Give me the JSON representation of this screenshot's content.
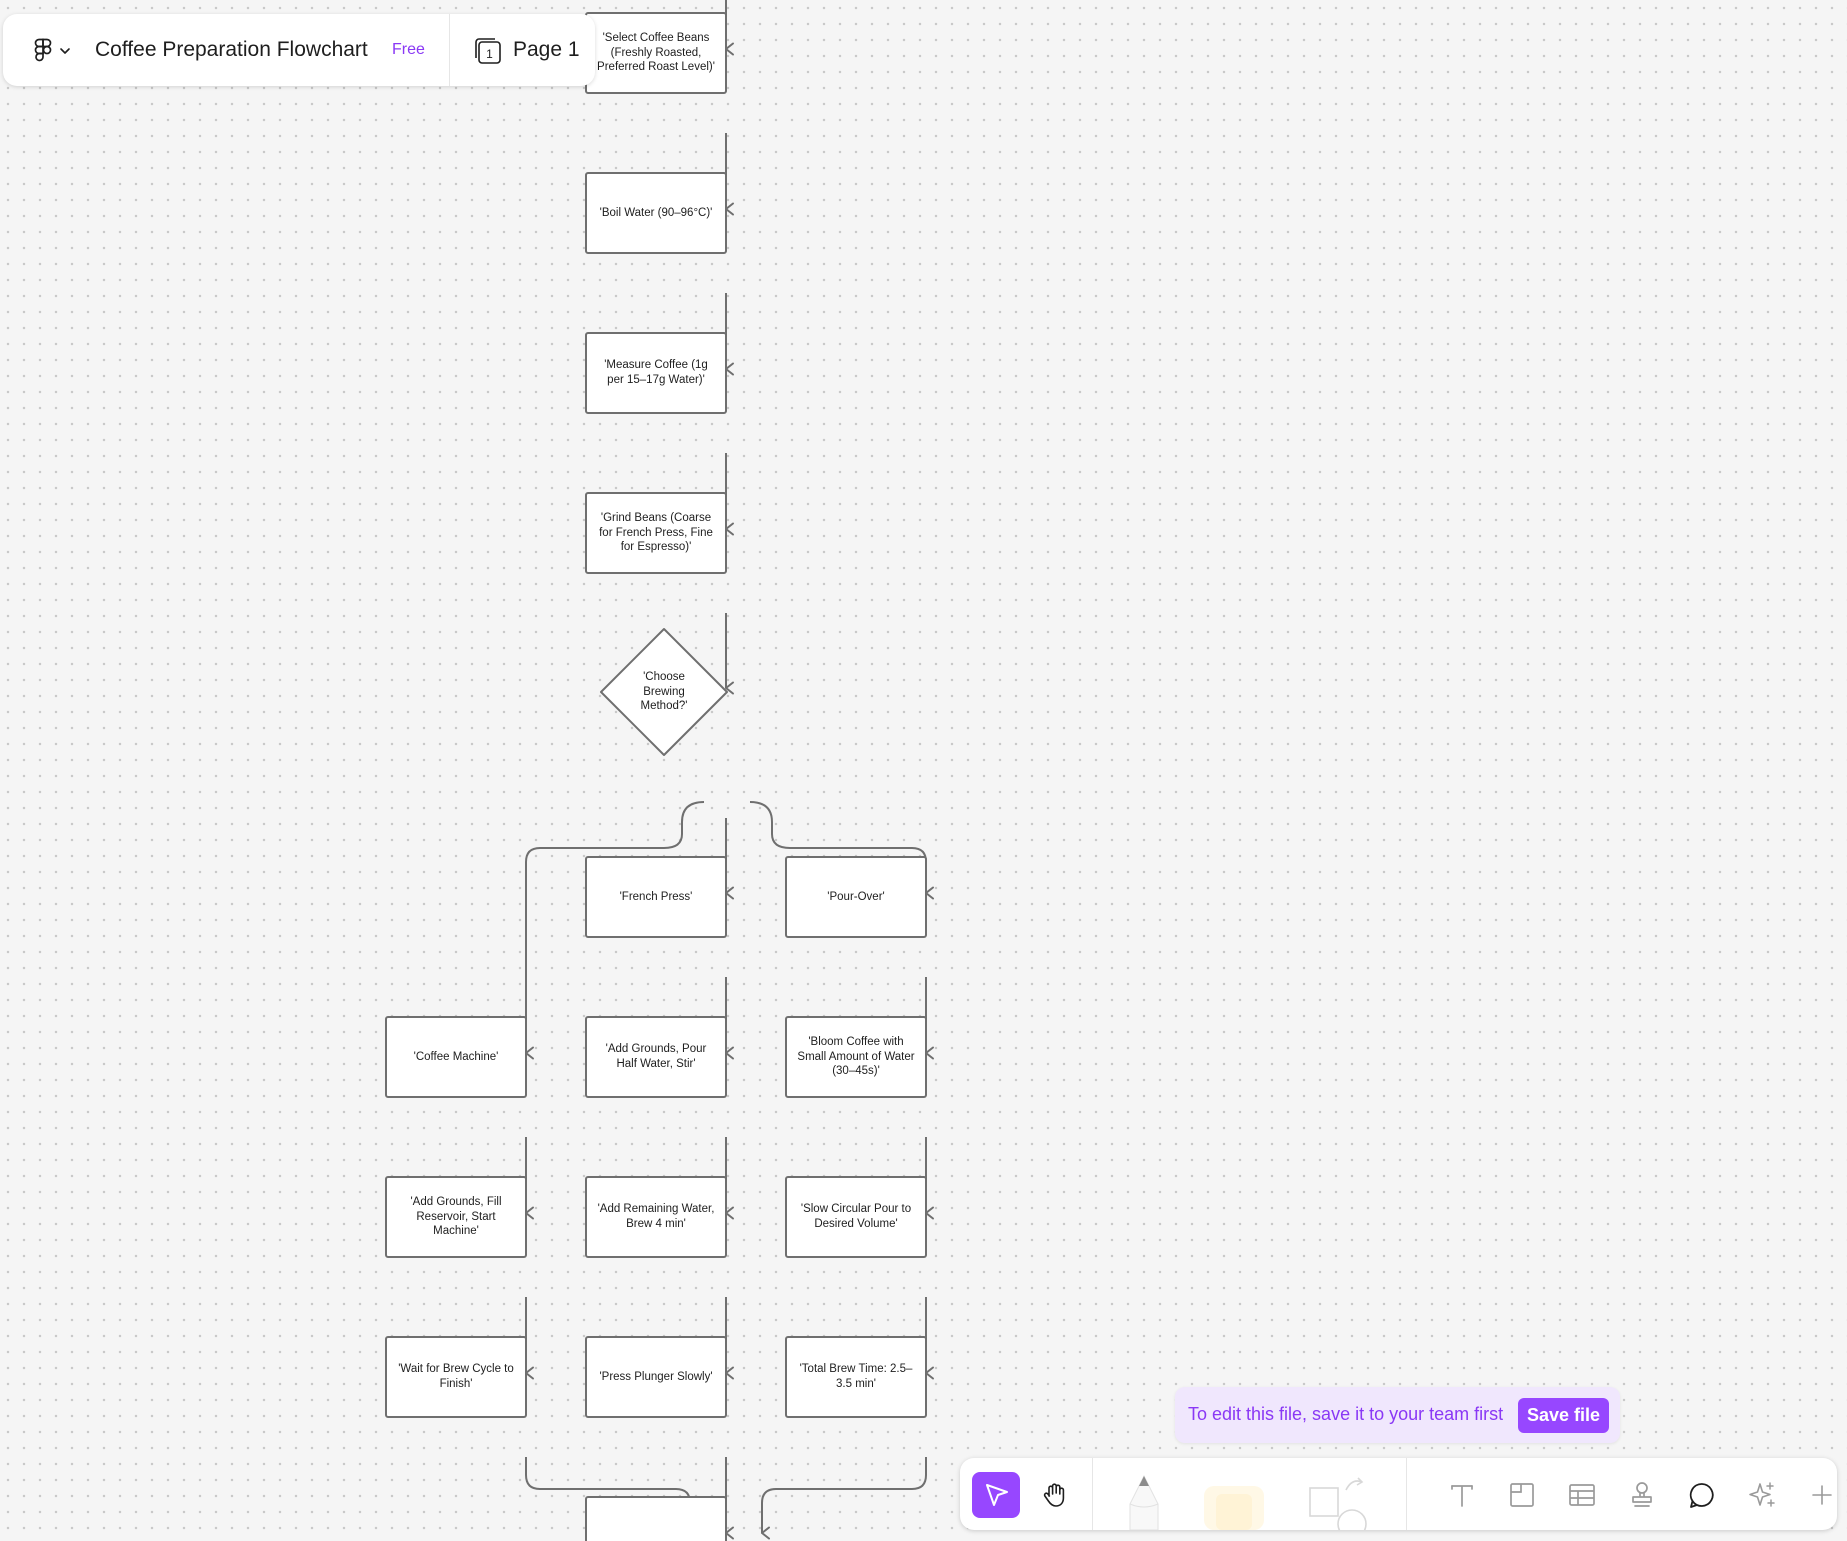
{
  "header": {
    "title": "Coffee Preparation Flowchart",
    "plan_badge": "Free",
    "page_label": "Page 1",
    "page_count": "1"
  },
  "banner": {
    "text": "To edit this file, save it to your team first",
    "button_label": "Save file"
  },
  "toolbar": {
    "tools": [
      {
        "id": "move",
        "icon": "cursor-icon",
        "active": true
      },
      {
        "id": "hand",
        "icon": "hand-icon"
      },
      {
        "id": "pen",
        "icon": "pen-icon"
      },
      {
        "id": "highlighter",
        "icon": "highlighter-icon"
      },
      {
        "id": "shapes",
        "icon": "shape-icon"
      },
      {
        "id": "text",
        "icon": "text-icon"
      },
      {
        "id": "section",
        "icon": "section-icon"
      },
      {
        "id": "table",
        "icon": "table-icon"
      },
      {
        "id": "stamp",
        "icon": "stamp-icon"
      },
      {
        "id": "comment",
        "icon": "comment-icon"
      },
      {
        "id": "ai",
        "icon": "sparkle-icon"
      },
      {
        "id": "more",
        "icon": "plus-icon"
      }
    ],
    "accent": "#9747ff"
  },
  "colors": {
    "stroke": "#6f6f6f",
    "node_fill": "#ffffff",
    "canvas": "#f5f5f5",
    "accent_text": "#8a38f5",
    "banner_bg": "#f0e7fd"
  },
  "diagram": {
    "nodes": [
      {
        "id": "select_beans",
        "shape": "rect",
        "text": "'Select Coffee Beans (Freshly Roasted, Preferred Roast Level)'"
      },
      {
        "id": "boil_water",
        "shape": "rect",
        "text": "'Boil Water (90–96°C)'"
      },
      {
        "id": "measure",
        "shape": "rect",
        "text": "'Measure Coffee (1g per 15–17g Water)'"
      },
      {
        "id": "grind",
        "shape": "rect",
        "text": "'Grind Beans (Coarse for French Press, Fine for Espresso)'"
      },
      {
        "id": "choose",
        "shape": "diamond",
        "text": "'Choose Brewing Method?'"
      },
      {
        "id": "french_press",
        "shape": "rect",
        "text": "'French Press'"
      },
      {
        "id": "pour_over",
        "shape": "rect",
        "text": "'Pour-Over'"
      },
      {
        "id": "coffee_machine",
        "shape": "rect",
        "text": "'Coffee Machine'"
      },
      {
        "id": "fp_add",
        "shape": "rect",
        "text": "'Add Grounds, Pour Half Water, Stir'"
      },
      {
        "id": "po_bloom",
        "shape": "rect",
        "text": "'Bloom Coffee with Small Amount of Water (30–45s)'"
      },
      {
        "id": "cm_add",
        "shape": "rect",
        "text": "'Add Grounds, Fill Reservoir, Start Machine'"
      },
      {
        "id": "fp_brew",
        "shape": "rect",
        "text": "'Add Remaining Water, Brew 4 min'"
      },
      {
        "id": "po_pour",
        "shape": "rect",
        "text": "'Slow Circular Pour to Desired Volume'"
      },
      {
        "id": "cm_wait",
        "shape": "rect",
        "text": "'Wait for Brew Cycle to Finish'"
      },
      {
        "id": "fp_press",
        "shape": "rect",
        "text": "'Press Plunger Slowly'"
      },
      {
        "id": "po_total",
        "shape": "rect",
        "text": "'Total Brew Time: 2.5–3.5 min'"
      },
      {
        "id": "next_step",
        "shape": "rect",
        "text": ""
      }
    ],
    "edges": [
      [
        "start",
        "select_beans"
      ],
      [
        "select_beans",
        "boil_water"
      ],
      [
        "boil_water",
        "measure"
      ],
      [
        "measure",
        "grind"
      ],
      [
        "grind",
        "choose"
      ],
      [
        "choose",
        "french_press"
      ],
      [
        "choose",
        "pour_over"
      ],
      [
        "choose",
        "coffee_machine"
      ],
      [
        "french_press",
        "fp_add"
      ],
      [
        "pour_over",
        "po_bloom"
      ],
      [
        "coffee_machine",
        "cm_add"
      ],
      [
        "fp_add",
        "fp_brew"
      ],
      [
        "po_bloom",
        "po_pour"
      ],
      [
        "cm_add",
        "cm_wait"
      ],
      [
        "fp_brew",
        "fp_press"
      ],
      [
        "po_pour",
        "po_total"
      ],
      [
        "cm_wait",
        "next_step"
      ],
      [
        "fp_press",
        "next_step"
      ],
      [
        "po_total",
        "next_step"
      ]
    ]
  }
}
